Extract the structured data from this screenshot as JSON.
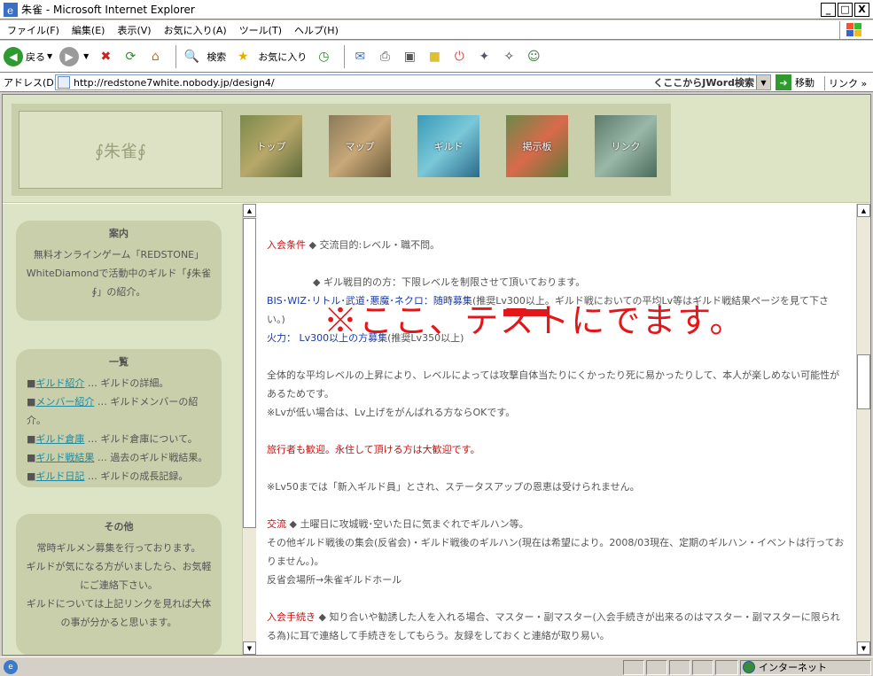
{
  "window": {
    "title": "朱雀 - Microsoft Internet Explorer",
    "controls": [
      "_",
      "□",
      "X"
    ]
  },
  "menubar": {
    "items": [
      "ファイル(F)",
      "編集(E)",
      "表示(V)",
      "お気に入り(A)",
      "ツール(T)",
      "ヘルプ(H)"
    ]
  },
  "toolbar": {
    "back_label": "戻る",
    "search_label": "検索",
    "favorites_label": "お気に入り"
  },
  "address": {
    "label": "アドレス(D)",
    "url": "http://redstone7white.nobody.jp/design4/",
    "search_hint": "くここからJWord検索",
    "go_label": "移動",
    "links_label": "リンク »"
  },
  "site": {
    "logo": "∮朱雀∮",
    "nav": [
      "トップ",
      "マップ",
      "ギルド",
      "掲示板",
      "リンク"
    ]
  },
  "sidebar": {
    "guide": {
      "title": "案内",
      "text": "無料オンラインゲーム「REDSTONE」WhiteDiamondで活動中のギルド「∮朱雀∮」の紹介。"
    },
    "list": {
      "title": "一覧",
      "items": [
        {
          "link": "ギルド紹介",
          "desc": "… ギルドの詳細。"
        },
        {
          "link": "メンバー紹介",
          "desc": "… ギルドメンバーの紹介。"
        },
        {
          "link": "ギルド倉庫",
          "desc": "… ギルド倉庫について。"
        },
        {
          "link": "ギルド戦結果",
          "desc": "… 過去のギルド戦結果。"
        },
        {
          "link": "ギルド日記",
          "desc": "… ギルドの成長記録。"
        }
      ]
    },
    "other": {
      "title": "その他",
      "lines": [
        "常時ギルメン募集を行っております。",
        "ギルドが気になる方がいましたら、お気軽にご連絡下さい。",
        "ギルドについては上記リンクを見れば大体の事が分かると思います。"
      ]
    }
  },
  "content": {
    "join_label": "入会条件",
    "join_text": "◆ 交流目的:レベル・職不問。",
    "guildwar_text": "◆ ギル戦目的の方：下限レベルを制限させて頂いております。",
    "bis_label": "BIS･WIZ･リトル･武道･悪魔･ネクロ：随時募集",
    "bis_text": "(推奨Lv300以上。ギルド戦においての平均Lv等はギルド戦結果ページを見て下さい。)",
    "fire_label": "火力： Lv300以上の方募集",
    "fire_text": "(推奨Lv350以上)",
    "overlay": "※ここ、テストにでます。",
    "level_note": "全体的な平均レベルの上昇により、レベルによっては攻撃自体当たりにくかったり死に易かったりして、本人が楽しめない可能性があるためです。",
    "low_level_note": "※Lvが低い場合は、Lv上げをがんばれる方ならOKです。",
    "traveler": "旅行者も歓迎。永住して頂ける方は大歓迎です。",
    "lv50_note": "※Lv50までは「新入ギルド員」とされ、ステータスアップの恩恵は受けられません。",
    "exchange_label": "交流",
    "exchange_text": "◆ 土曜日に攻城戦･空いた日に気まぐれでギルハン等。",
    "exchange_more": "その他ギルド戦後の集会(反省会)・ギルド戦後のギルハン(現在は希望により。2008/03現在、定期のギルハン・イベントは行っておりません。)。",
    "hall": "反省会場所→朱雀ギルドホール",
    "procedure_label": "入会手続き",
    "procedure_text": "◆ 知り合いや勧誘した人を入れる場合、マスター・副マスター(入会手続きが出来るのはマスター・副マスターに限られる為)に耳で連絡して手続きをしてもらう。友録をしておくと連絡が取り易い。"
  },
  "status": {
    "zone": "インターネット"
  }
}
